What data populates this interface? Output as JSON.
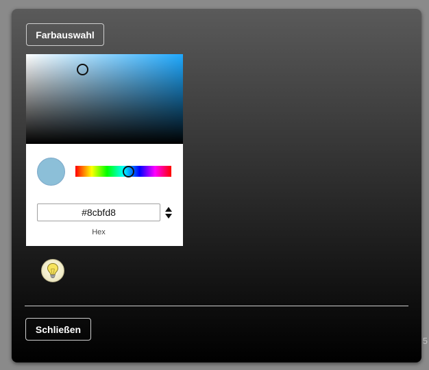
{
  "background": {
    "edge_text": "5"
  },
  "dialog": {
    "color_select_button_label": "Farbauswahl",
    "close_button_label": "Schließen"
  },
  "color_picker": {
    "hex_value": "#8cbfd8",
    "format_label": "Hex",
    "hue_color": "#1fa9ff",
    "preview_color": "#8cbfd8"
  },
  "icons": {
    "bulb": "lightbulb-icon",
    "format_toggle": "up-down-arrows-icon"
  }
}
